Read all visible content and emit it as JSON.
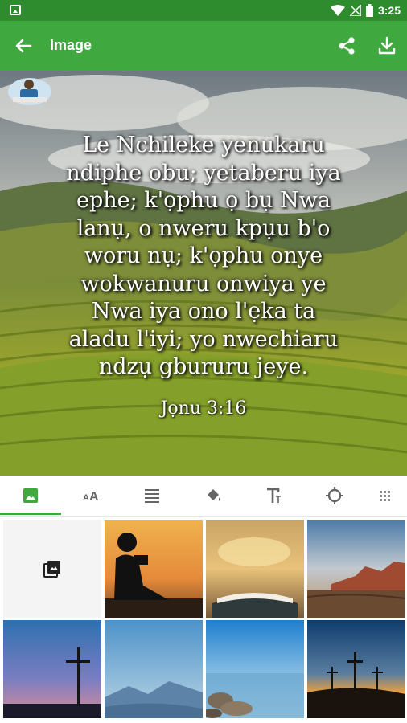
{
  "status_bar": {
    "time": "3:25"
  },
  "app_bar": {
    "title": "Image"
  },
  "verse": {
    "lines": [
      "Le Nchileke yenukaru",
      "ndiphe obu; yetaberu iya",
      "ephe; k'ọphu ọ bụ Nwa",
      "lanụ, o nweru kpụu b'o",
      "woru nụ; k'ọphu onye",
      "wokwanuru onwiya ye",
      "Nwa iya ono l'ẹka ta",
      "aladu l'iyi; yo nwechiaru",
      "ndzụ gbururu jeye."
    ],
    "reference": "Jọnu 3:16"
  },
  "tabs": [
    {
      "name": "image-tab-icon",
      "selected": true
    },
    {
      "name": "font-size-tab-icon",
      "selected": false
    },
    {
      "name": "align-tab-icon",
      "selected": false
    },
    {
      "name": "color-fill-tab-icon",
      "selected": false
    },
    {
      "name": "text-style-tab-icon",
      "selected": false
    },
    {
      "name": "brightness-tab-icon",
      "selected": false
    },
    {
      "name": "grid-tab-icon",
      "selected": false
    }
  ],
  "colors": {
    "status_bar": "#2e8b2e",
    "app_bar": "#3fa83f",
    "accent": "#3fa83f"
  },
  "backgrounds": [
    {
      "name": "gallery-picker",
      "icon": "gallery-icon"
    },
    {
      "name": "boy-reading-sunset"
    },
    {
      "name": "open-bible-golden"
    },
    {
      "name": "desert-canyon"
    },
    {
      "name": "cross-twilight"
    },
    {
      "name": "misty-mountains"
    },
    {
      "name": "calm-shore"
    },
    {
      "name": "three-crosses-sunset"
    }
  ]
}
